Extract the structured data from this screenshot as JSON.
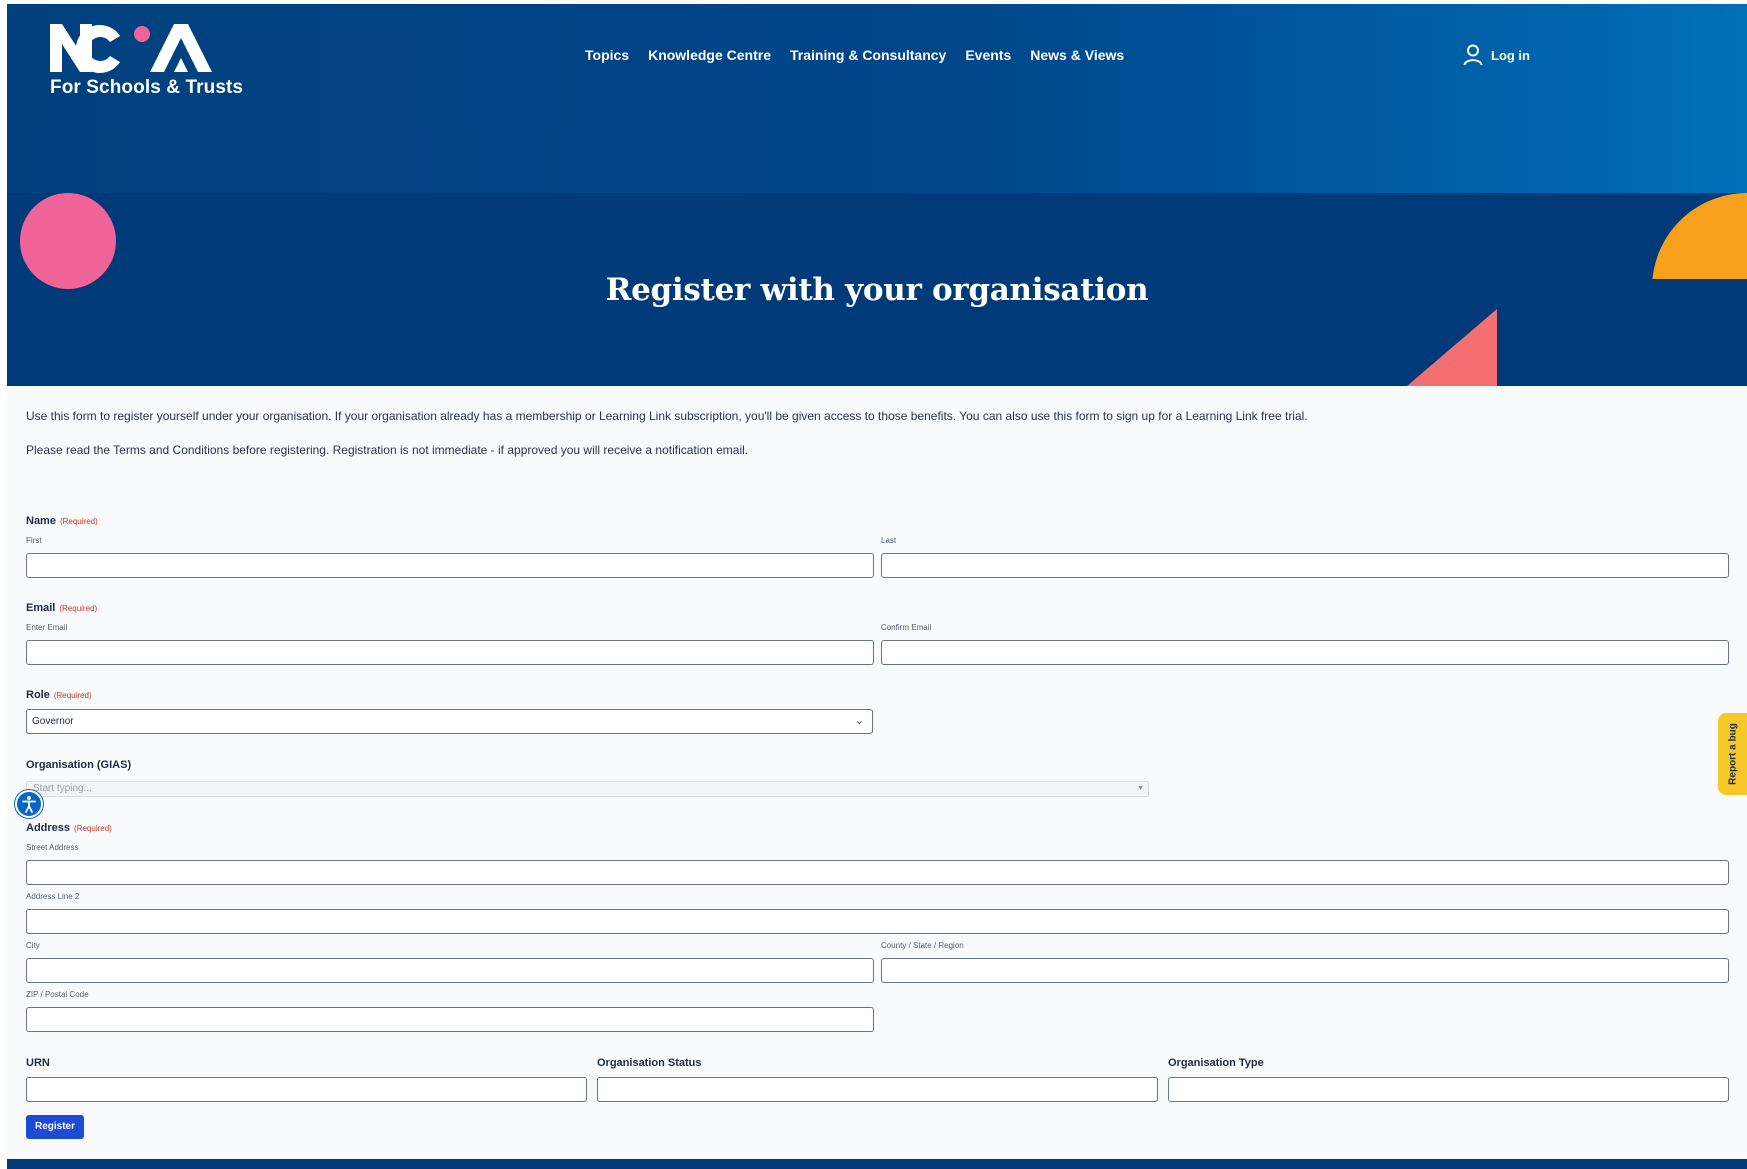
{
  "brand": {
    "logo_text": "NGA",
    "tagline": "For Schools & Trusts",
    "colors": {
      "navy": "#003a78",
      "pink": "#f0649a",
      "orange": "#f7a01c",
      "coral": "#f46f6f",
      "button": "#1e4bd6"
    }
  },
  "nav": {
    "items": [
      "Topics",
      "Knowledge Centre",
      "Training & Consultancy",
      "Events",
      "News & Views"
    ],
    "login_label": "Log in",
    "login_icon": "user-icon"
  },
  "hero": {
    "title": "Register with your organisation"
  },
  "intro": {
    "p1": "Use this form to register yourself under your organisation. If your organisation already has a membership or Learning Link subscription, you'll be given access to those benefits. You can also use this form to sign up for a Learning Link free trial.",
    "p2": "Please read the Terms and Conditions before registering. Registration is not immediate - if approved you will receive a notification email."
  },
  "form": {
    "required_text": "(Required)",
    "name": {
      "label": "Name",
      "first": "First",
      "last": "Last"
    },
    "email": {
      "label": "Email",
      "enter": "Enter Email",
      "confirm": "Confirm Email"
    },
    "role": {
      "label": "Role",
      "value": "Governor"
    },
    "organisation": {
      "label": "Organisation (GIAS)",
      "placeholder": "Start typing..."
    },
    "address": {
      "label": "Address",
      "street": "Street Address",
      "line2": "Address Line 2",
      "city": "City",
      "county": "County / State / Region",
      "zip": "ZIP / Postal Code"
    },
    "urn": "URN",
    "org_status": "Organisation Status",
    "org_type": "Organisation Type",
    "submit": "Register"
  },
  "widgets": {
    "report_bug": "Report a bug",
    "accessibility_icon": "accessibility-icon"
  }
}
